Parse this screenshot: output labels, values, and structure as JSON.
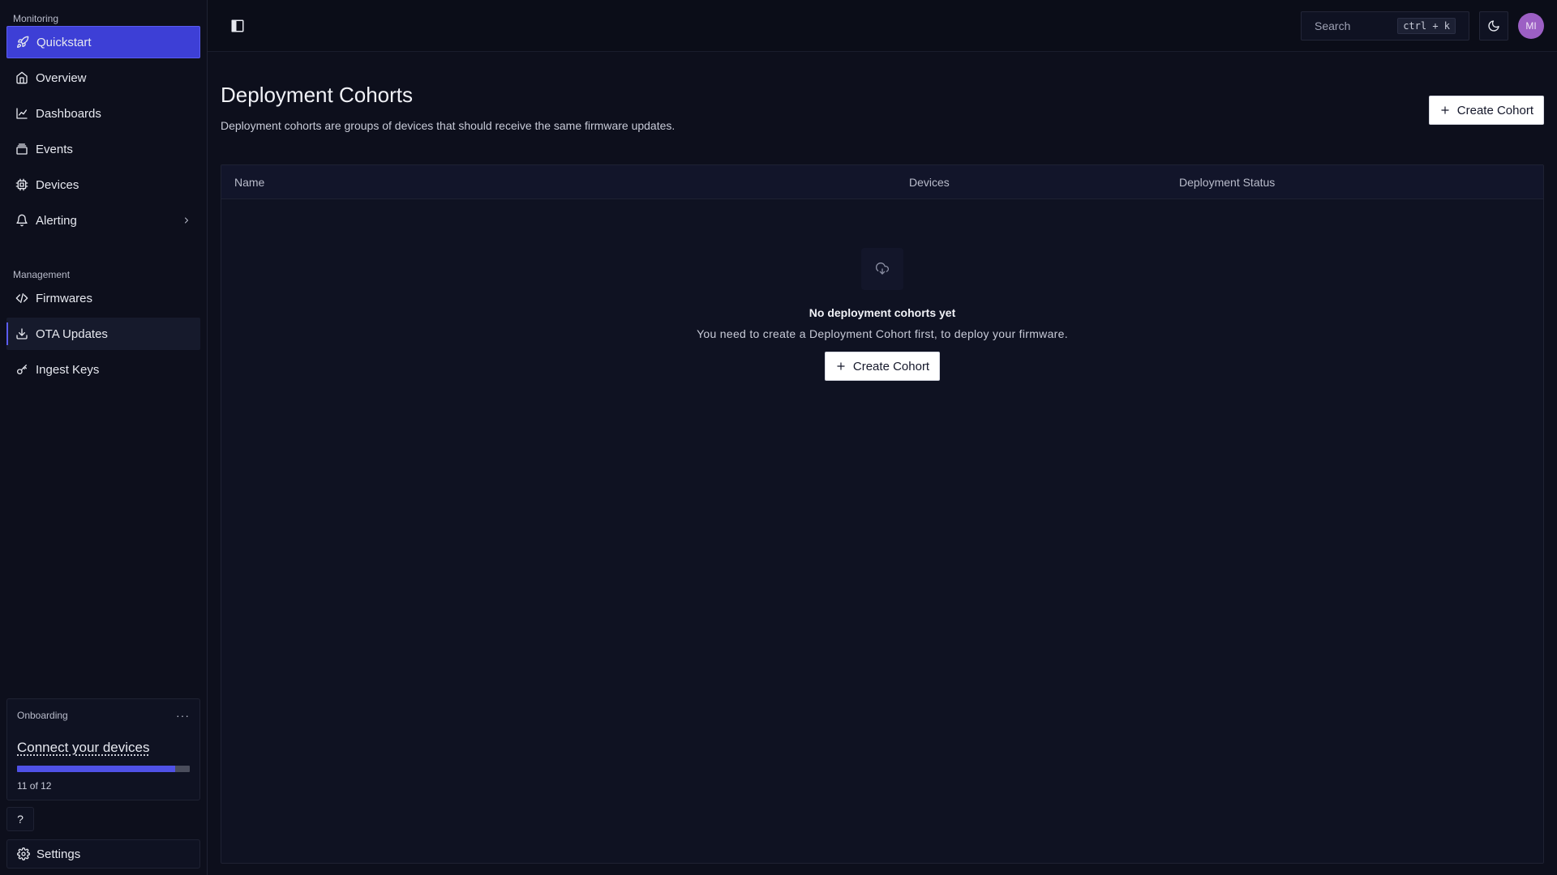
{
  "sidebar": {
    "monitoring_label": "Monitoring",
    "management_label": "Management",
    "monitoring_items": [
      {
        "label": "Quickstart",
        "icon": "rocket-icon"
      },
      {
        "label": "Overview",
        "icon": "home-icon"
      },
      {
        "label": "Dashboards",
        "icon": "chart-icon"
      },
      {
        "label": "Events",
        "icon": "layers-icon"
      },
      {
        "label": "Devices",
        "icon": "chip-icon"
      },
      {
        "label": "Alerting",
        "icon": "bell-icon"
      }
    ],
    "management_items": [
      {
        "label": "Firmwares",
        "icon": "code-icon"
      },
      {
        "label": "OTA Updates",
        "icon": "download-icon"
      },
      {
        "label": "Ingest Keys",
        "icon": "key-icon"
      }
    ],
    "onboarding": {
      "label": "Onboarding",
      "menu": "···",
      "title": "Connect your devices",
      "progress_fraction": 0.917,
      "count": "11 of 12"
    },
    "help_label": "?",
    "settings_label": "Settings"
  },
  "topbar": {
    "search_placeholder": "Search",
    "search_shortcut": "ctrl + k",
    "avatar_initials": "MI"
  },
  "page": {
    "title": "Deployment Cohorts",
    "description": "Deployment cohorts are groups of devices that should receive the same firmware updates.",
    "create_button": "Create Cohort"
  },
  "table": {
    "columns": [
      "Name",
      "Devices",
      "Deployment Status"
    ],
    "empty_title": "No deployment cohorts yet",
    "empty_description": "You need to create a Deployment Cohort first, to deploy your firmware.",
    "empty_button": "Create Cohort"
  },
  "colors": {
    "accent": "#3d3fd6",
    "background": "#0d0f1c",
    "avatar": "#9c5fc4"
  }
}
